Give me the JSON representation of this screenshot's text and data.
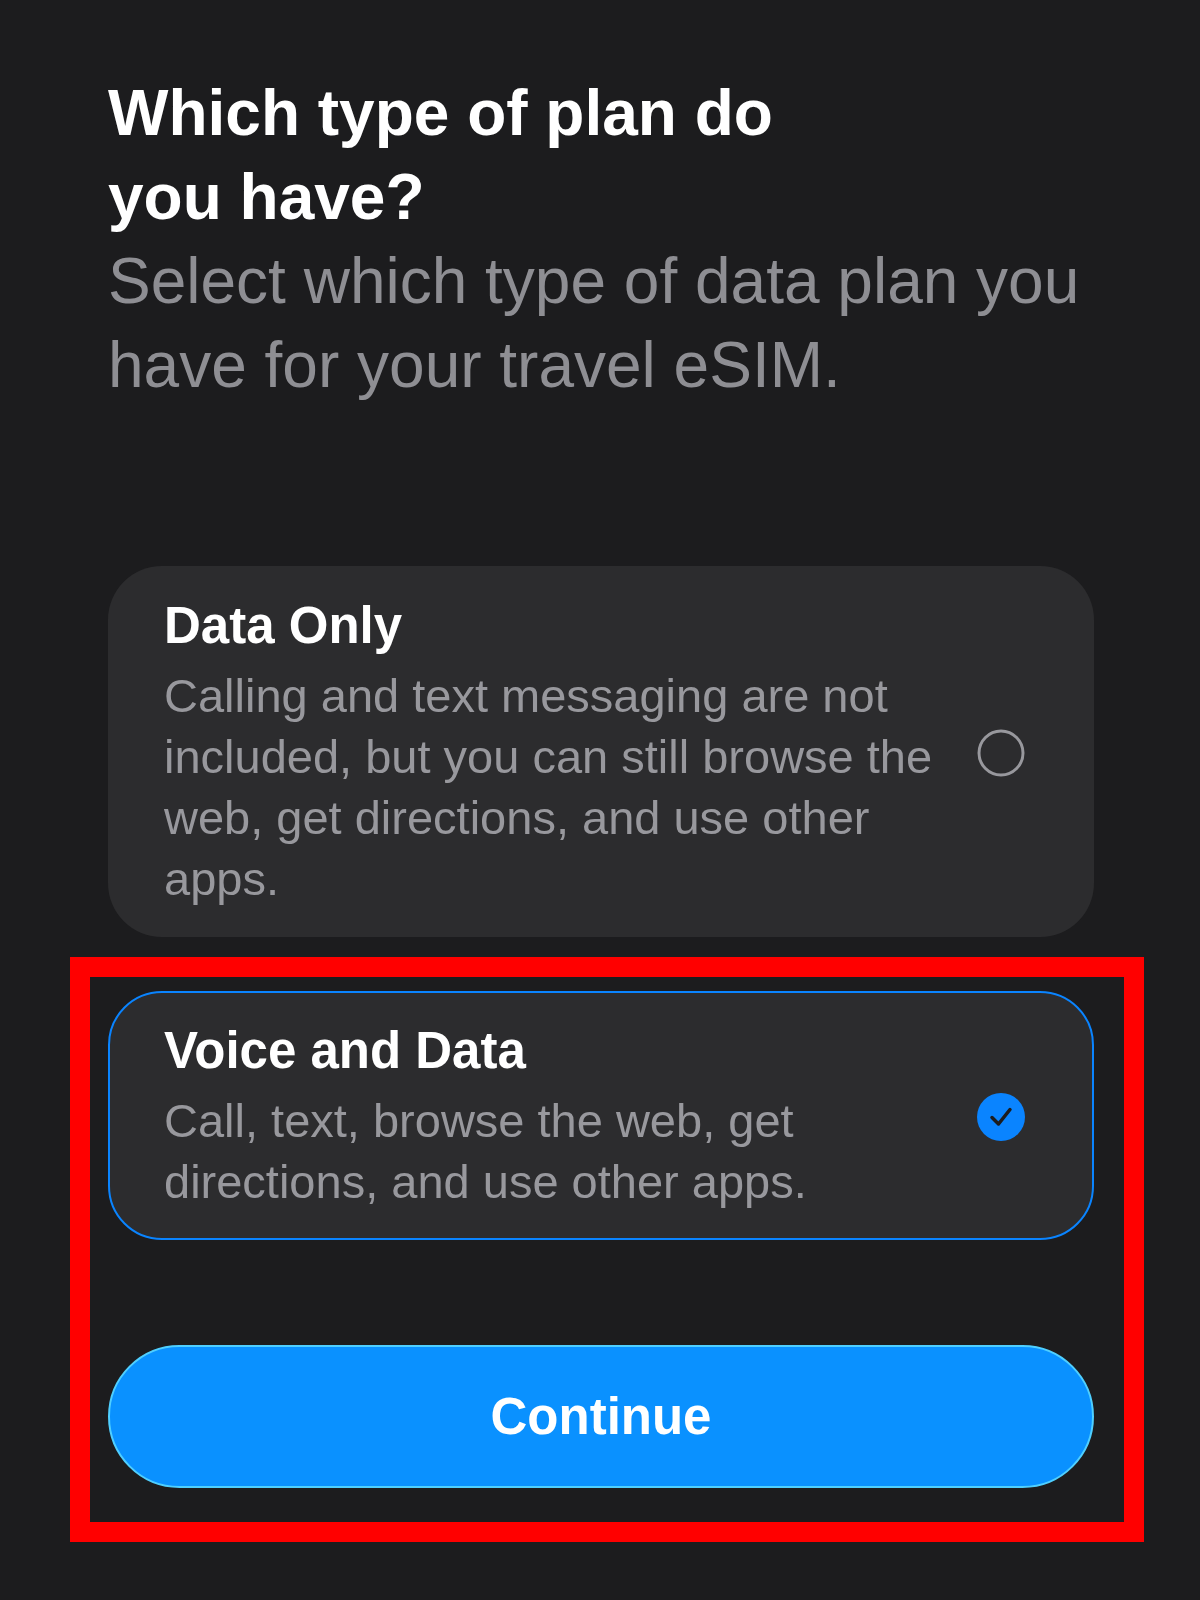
{
  "title": "Which type of plan do you have?",
  "subtitle": "Select which type of data plan you have for your travel eSIM.",
  "options": [
    {
      "title": "Data Only",
      "description": "Calling and text messaging are not included, but you can still browse the web, get directions, and use other apps.",
      "selected": false
    },
    {
      "title": "Voice and Data",
      "description": "Call, text, browse the web, get directions, and use other apps.",
      "selected": true
    }
  ],
  "continue_button": {
    "label": "Continue"
  },
  "annotation": {
    "kind": "rectangle"
  }
}
